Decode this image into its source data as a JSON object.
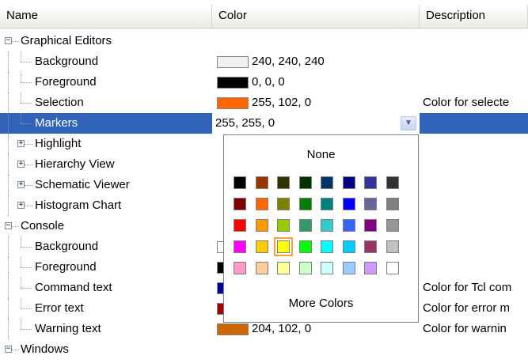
{
  "header": {
    "name": "Name",
    "color": "Color",
    "description": "Description"
  },
  "rows": [
    {
      "kind": "group",
      "label": "Graphical Editors",
      "expander": "−"
    },
    {
      "kind": "leaf",
      "label": "Background",
      "swatch": "#f0f0f0",
      "value": "240, 240, 240",
      "desc": ""
    },
    {
      "kind": "leaf",
      "label": "Foreground",
      "swatch": "#000000",
      "value": "0, 0, 0",
      "desc": ""
    },
    {
      "kind": "leaf",
      "label": "Selection",
      "swatch": "#ff6600",
      "value": "255, 102, 0",
      "desc": "Color for selecte"
    },
    {
      "kind": "leaf",
      "label": "Markers",
      "selected": true,
      "value": "255, 255, 0",
      "desc": ""
    },
    {
      "kind": "sub",
      "label": "Highlight",
      "expander": "+"
    },
    {
      "kind": "sub",
      "label": "Hierarchy View",
      "expander": "+"
    },
    {
      "kind": "sub",
      "label": "Schematic Viewer",
      "expander": "+"
    },
    {
      "kind": "sub",
      "label": "Histogram Chart",
      "expander": "+"
    },
    {
      "kind": "group",
      "label": "Console",
      "expander": "−"
    },
    {
      "kind": "leaf",
      "label": "Background",
      "swatch": "#ffffff",
      "value": "",
      "desc": ""
    },
    {
      "kind": "leaf",
      "label": "Foreground",
      "swatch": "#000000",
      "value": "",
      "desc": ""
    },
    {
      "kind": "leaf",
      "label": "Command text",
      "swatch": "#0000a0",
      "value": "",
      "desc": "Color for Tcl com"
    },
    {
      "kind": "leaf",
      "label": "Error text",
      "swatch": "#a00000",
      "value": "",
      "desc": "Color for error m"
    },
    {
      "kind": "leaf",
      "label": "Warning text",
      "swatch": "#cc6600",
      "value": "204, 102, 0",
      "desc": "Color for warnin"
    },
    {
      "kind": "group",
      "label": "Windows",
      "expander": "−"
    }
  ],
  "palette": {
    "none_label": "None",
    "more_label": "More Colors",
    "highlighted": [
      3,
      2
    ],
    "colors": [
      [
        "#000000",
        "#993300",
        "#333300",
        "#003300",
        "#003366",
        "#000080",
        "#333399",
        "#333333"
      ],
      [
        "#800000",
        "#ff6600",
        "#808000",
        "#008000",
        "#008080",
        "#0000ff",
        "#666699",
        "#808080"
      ],
      [
        "#ff0000",
        "#ff9900",
        "#99cc00",
        "#339966",
        "#33cccc",
        "#3366ff",
        "#800080",
        "#969696"
      ],
      [
        "#ff00ff",
        "#ffcc00",
        "#ffff00",
        "#00ff00",
        "#00ffff",
        "#00ccff",
        "#993366",
        "#c0c0c0"
      ],
      [
        "#ff99cc",
        "#ffcc99",
        "#ffff99",
        "#ccffcc",
        "#ccffff",
        "#99ccff",
        "#cc99ff",
        "#ffffff"
      ]
    ]
  },
  "icons": {
    "dropdown": "chevron-down-icon"
  }
}
